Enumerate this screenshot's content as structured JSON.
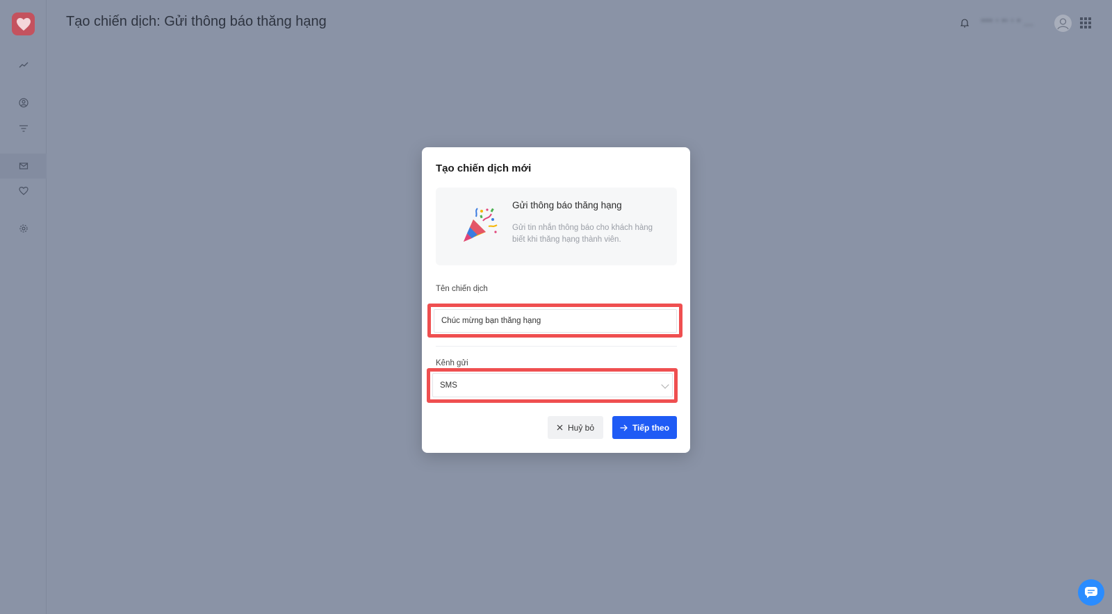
{
  "header": {
    "title": "Tạo chiến dịch: Gửi thông báo thăng hạng",
    "username": "\"\"\" ' \"' ' \" ..."
  },
  "sidebar": {
    "items": [
      {
        "icon": "analytics-icon"
      },
      {
        "icon": "user-icon"
      },
      {
        "icon": "filter-icon"
      },
      {
        "icon": "mail-icon",
        "active": true
      },
      {
        "icon": "heart-icon"
      },
      {
        "icon": "settings-icon"
      }
    ]
  },
  "modal": {
    "title": "Tạo chiến dịch mới",
    "template": {
      "name": "Gửi thông báo thăng hạng",
      "description": "Gửi tin nhắn thông báo cho khách hàng biết khi thăng hạng thành viên.",
      "icon": "party-popper-icon"
    },
    "campaign_name": {
      "label": "Tên chiến dịch",
      "value": "Chúc mừng bạn thăng hạng"
    },
    "channel": {
      "label": "Kênh gửi",
      "value": "SMS"
    },
    "cancel_label": "Huỷ bỏ",
    "next_label": "Tiếp theo"
  },
  "colors": {
    "highlight": "#ef4f50",
    "primary": "#1f5bf5",
    "brand": "#c4525e"
  }
}
